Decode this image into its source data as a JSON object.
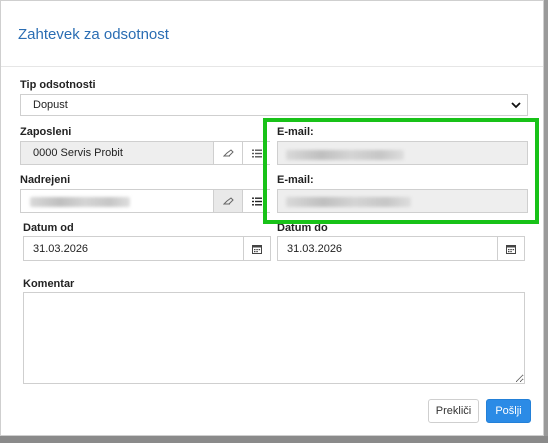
{
  "dialog": {
    "title": "Zahtevek za odsotnost",
    "absence_type_label": "Tip odsotnosti",
    "absence_type_value": "Dopust",
    "employee_label": "Zaposleni",
    "employee_value": "0000 Servis Probit",
    "employee_email_label": "E-mail:",
    "supervisor_label": "Nadrejeni",
    "supervisor_email_label": "E-mail:",
    "date_from_label": "Datum od",
    "date_from_value": "31.03.2026",
    "date_to_label": "Datum do",
    "date_to_value": "31.03.2026",
    "comment_label": "Komentar",
    "comment_value": "",
    "cancel_label": "Prekliči",
    "send_label": "Pošlji"
  },
  "colors": {
    "title": "#2a6db3",
    "primary_button": "#2b8be6",
    "highlight_frame": "#18c218"
  }
}
